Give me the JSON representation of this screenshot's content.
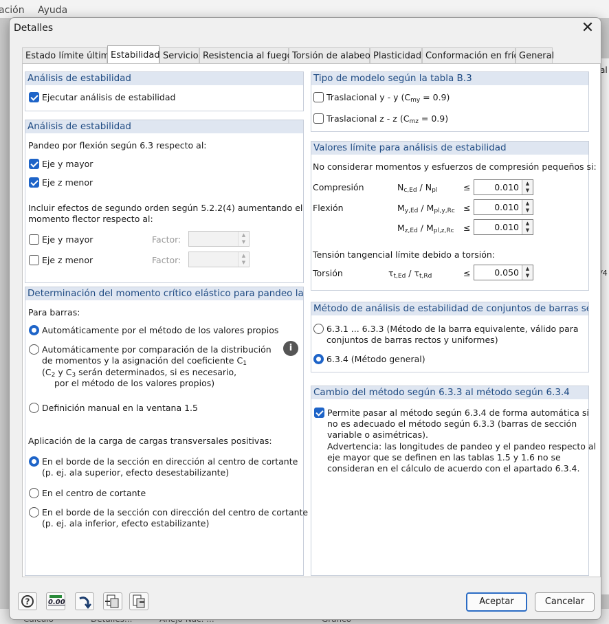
{
  "background": {
    "menu": [
      "ación",
      "Ayuda"
    ],
    "bottom_tabs": [
      "Cálculo",
      "Detalles...",
      "Anejo Nac. ...",
      "Gráfico"
    ],
    "right_labels": [
      "al",
      "/4"
    ]
  },
  "dialog": {
    "title": "Detalles",
    "tabs": [
      "Estado límite último",
      "Estabilidad",
      "Servicio",
      "Resistencia al fuego",
      "Torsión de alabeo",
      "Plasticidad",
      "Conformación en frío",
      "General"
    ],
    "active_tab": "Estabilidad"
  },
  "left": {
    "g1": {
      "title": "Análisis de estabilidad",
      "execute_label": "Ejecutar análisis de estabilidad",
      "execute_checked": true
    },
    "g2": {
      "title": "Análisis de estabilidad",
      "flexion_intro": "Pandeo por flexión según 6.3 respecto al:",
      "y_major": "Eje y mayor",
      "z_minor": "Eje z menor",
      "second_order_line1": "Incluir efectos de segundo orden según 5.2.2(4) aumentando el",
      "second_order_line2": "momento flector respecto al:",
      "y_major2": "Eje y mayor",
      "z_minor2": "Eje z menor",
      "factor_label": "Factor:"
    },
    "g3": {
      "title": "Determinación del momento crítico elástico para pandeo later",
      "for_bars": "Para barras:",
      "opt1": "Automáticamente por el método de los valores propios",
      "opt2_l1": "Automáticamente por comparación de la distribución",
      "opt2_l2": "de momentos y la asignación del coeficiente C",
      "opt2_l3": "(C",
      "opt2_l3b": " y C",
      "opt2_l3c": " serán determinados, si es necesario,",
      "opt2_l4": "por el método de los valores propios)",
      "sub1": "1",
      "sub2": "2",
      "sub3": "3",
      "opt3": "Definición manual en la ventana 1.5",
      "load_title": "Aplicación de la carga de cargas transversales positivas:",
      "load1_l1": "En el borde de la sección en dirección al centro de cortante",
      "load1_l2": "(p. ej. ala superior, efecto desestabilizante)",
      "load2": "En el centro de cortante",
      "load3_l1": "En el borde de la sección con dirección del centro de cortante",
      "load3_l2": "(p. ej. ala inferior, efecto estabilizante)"
    }
  },
  "right": {
    "g1": {
      "title": "Tipo de modelo según la tabla B.3",
      "opt_y": "Traslacional y - y (C",
      "opt_y_sub": "my",
      "opt_y_end": " = 0.9)",
      "opt_z": "Traslacional z - z (C",
      "opt_z_sub": "mz",
      "opt_z_end": " = 0.9)"
    },
    "g2": {
      "title": "Valores límite para análisis de estabilidad",
      "intro": "No considerar momentos y esfuerzos de compresión pequeños si:",
      "compresion": "Compresión",
      "flexion": "Flexión",
      "tension_intro": "Tensión tangencial límite debido a torsión:",
      "torsion": "Torsión",
      "leq": "≤",
      "val_comp": "0.010",
      "val_flex_y": "0.010",
      "val_flex_z": "0.010",
      "val_tors": "0.050",
      "f_comp_a": "N",
      "f_comp_asub": "c,Ed",
      "f_comp_b": " / N",
      "f_comp_bsub": "pl",
      "f_y_a": "M",
      "f_y_asub": "y,Ed",
      "f_y_b": " / M",
      "f_y_bsub": "pl,y,Rc",
      "f_z_a": "M",
      "f_z_asub": "z,Ed",
      "f_z_b": " / M",
      "f_z_bsub": "pl,z,Rc",
      "f_t_a": "τ",
      "f_t_asub": "t,Ed",
      "f_t_b": " / τ",
      "f_t_bsub": "t,Rd"
    },
    "g3": {
      "title": "Método de análisis de estabilidad de conjuntos de barras seg",
      "opt1_l1": "6.3.1 ... 6.3.3 (Método de la barra equivalente, válido para",
      "opt1_l2": "conjuntos de barras rectos y uniformes)",
      "opt2": "6.3.4  (Método general)"
    },
    "g4": {
      "title": "Cambio del método según 6.3.3 al método según 6.3.4",
      "lines": [
        "Permite pasar al método según 6.3.4 de forma automática si",
        "no es adecuado el método según 6.3.3 (barras de sección",
        "variable o asimétricas).",
        "Advertencia: las longitudes de pandeo y el pandeo respecto al",
        "eje mayor que se definen en las tablas 1.5 y 1.6 no se",
        "consideran en el cálculo de acuerdo con el apartado 6.3.4."
      ]
    }
  },
  "footer": {
    "zero_label": "0.00",
    "ok": "Aceptar",
    "cancel": "Cancelar"
  }
}
